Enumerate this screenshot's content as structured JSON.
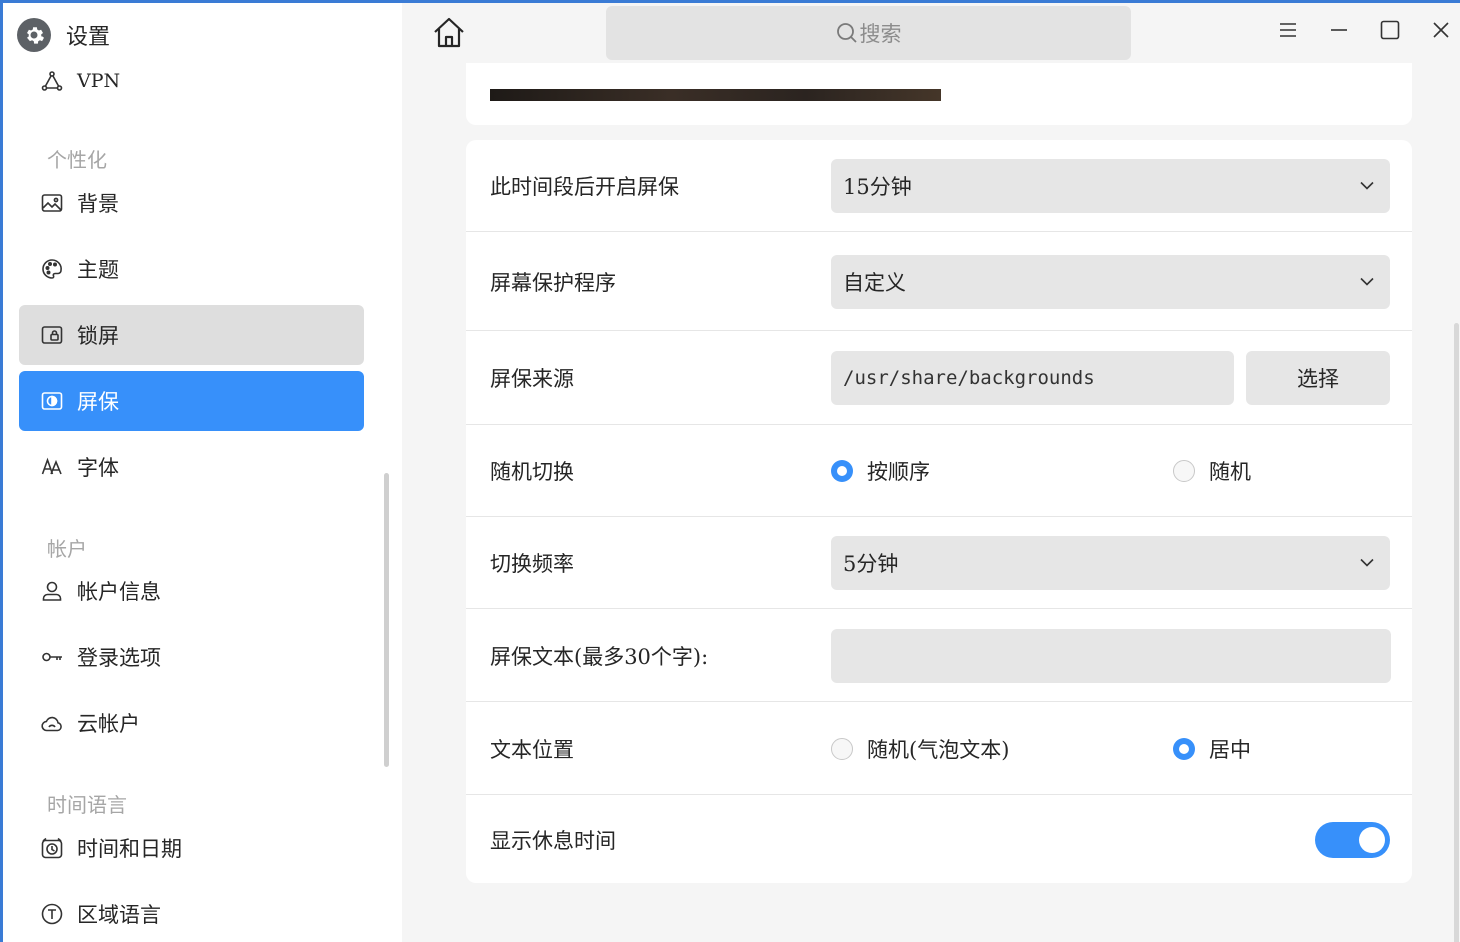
{
  "app": {
    "title": "设置"
  },
  "search": {
    "placeholder": "搜索"
  },
  "sidebar": {
    "vpn": "VPN",
    "groups": {
      "personalize": "个性化",
      "account": "帐户",
      "time_lang": "时间语言"
    },
    "items": {
      "background": "背景",
      "theme": "主题",
      "lockscreen": "锁屏",
      "screensaver": "屏保",
      "font": "字体",
      "account_info": "帐户信息",
      "login_options": "登录选项",
      "cloud_account": "云帐户",
      "datetime": "时间和日期",
      "region_lang": "区域语言"
    },
    "active_item": "屏保",
    "hovered_item": "锁屏"
  },
  "settings": {
    "idle": {
      "label": "此时间段后开启屏保",
      "value": "15分钟"
    },
    "program": {
      "label": "屏幕保护程序",
      "value": "自定义"
    },
    "source": {
      "label": "屏保来源",
      "value": "/usr/share/backgrounds",
      "button": "选择"
    },
    "random_switch": {
      "label": "随机切换",
      "opt_order": "按顺序",
      "opt_random": "随机",
      "selected": "按顺序"
    },
    "frequency": {
      "label": "切换频率",
      "value": "5分钟"
    },
    "text": {
      "label": "屏保文本(最多30个字):",
      "value": ""
    },
    "text_pos": {
      "label": "文本位置",
      "opt_random": "随机(气泡文本)",
      "opt_center": "居中",
      "selected": "居中"
    },
    "show_rest": {
      "label": "显示休息时间",
      "enabled": true
    }
  },
  "colors": {
    "accent": "#3790fa",
    "hover": "#dedede",
    "window_bg": "#f5f5f5"
  }
}
